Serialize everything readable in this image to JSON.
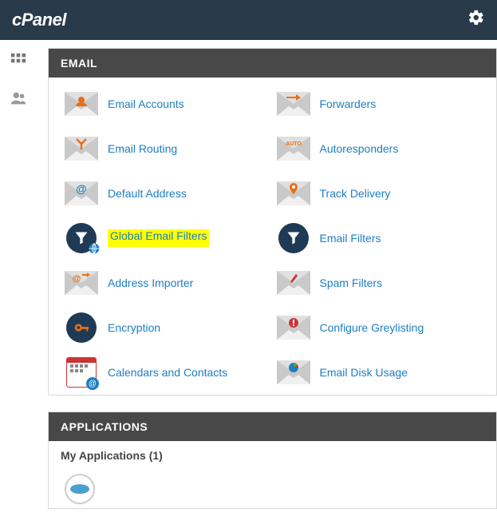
{
  "header": {
    "brand": "cPanel"
  },
  "panels": {
    "email": {
      "title": "EMAIL",
      "items": [
        {
          "label": "Email Accounts"
        },
        {
          "label": "Forwarders"
        },
        {
          "label": "Email Routing"
        },
        {
          "label": "Autoresponders"
        },
        {
          "label": "Default Address"
        },
        {
          "label": "Track Delivery"
        },
        {
          "label": "Global Email Filters",
          "highlighted": true
        },
        {
          "label": "Email Filters"
        },
        {
          "label": "Address Importer"
        },
        {
          "label": "Spam Filters"
        },
        {
          "label": "Encryption"
        },
        {
          "label": "Configure Greylisting"
        },
        {
          "label": "Calendars and Contacts"
        },
        {
          "label": "Email Disk Usage"
        }
      ]
    },
    "applications": {
      "title": "APPLICATIONS",
      "subheading": "My Applications (1)"
    }
  }
}
